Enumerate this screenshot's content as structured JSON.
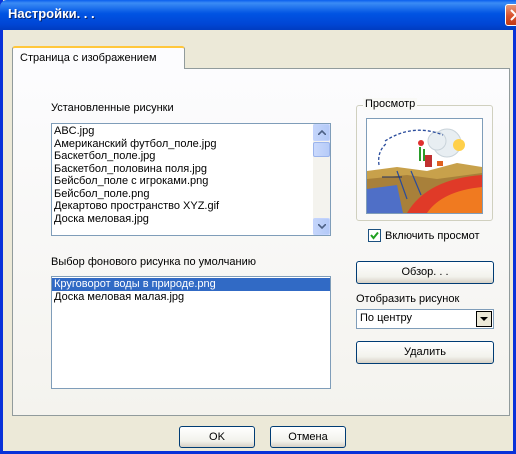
{
  "window": {
    "title": "Настройки. . ."
  },
  "tabs": [
    {
      "label": "Страница с изображением"
    }
  ],
  "installed": {
    "label": "Установленные рисунки",
    "items": [
      "ABC.jpg",
      "Американский футбол_поле.jpg",
      "Баскетбол_поле.jpg",
      "Баскетбол_половина поля.jpg",
      "Бейсбол_поле с игроками.png",
      "Бейсбол_поле.png",
      "Декартово пространство XYZ.gif",
      "Доска меловая.jpg"
    ]
  },
  "preview": {
    "group_title": "Просмотр",
    "checkbox_label": "Включить просмот",
    "checkbox_checked": true,
    "image_icon": "water-cycle-thumbnail"
  },
  "background": {
    "label": "Выбор фонового рисунка по умолчанию",
    "items": [
      "Круговорот воды в природе.png",
      "Доска меловая малая.jpg"
    ],
    "selected_index": 0
  },
  "buttons": {
    "browse": "Обзор. . .",
    "delete": "Удалить",
    "ok": "OK",
    "cancel": "Отмена"
  },
  "display": {
    "label": "Отобразить рисунок",
    "selected": "По центру"
  },
  "colors": {
    "titlebar": "#0054e3",
    "selection": "#316ac5",
    "close": "#d8512d"
  }
}
